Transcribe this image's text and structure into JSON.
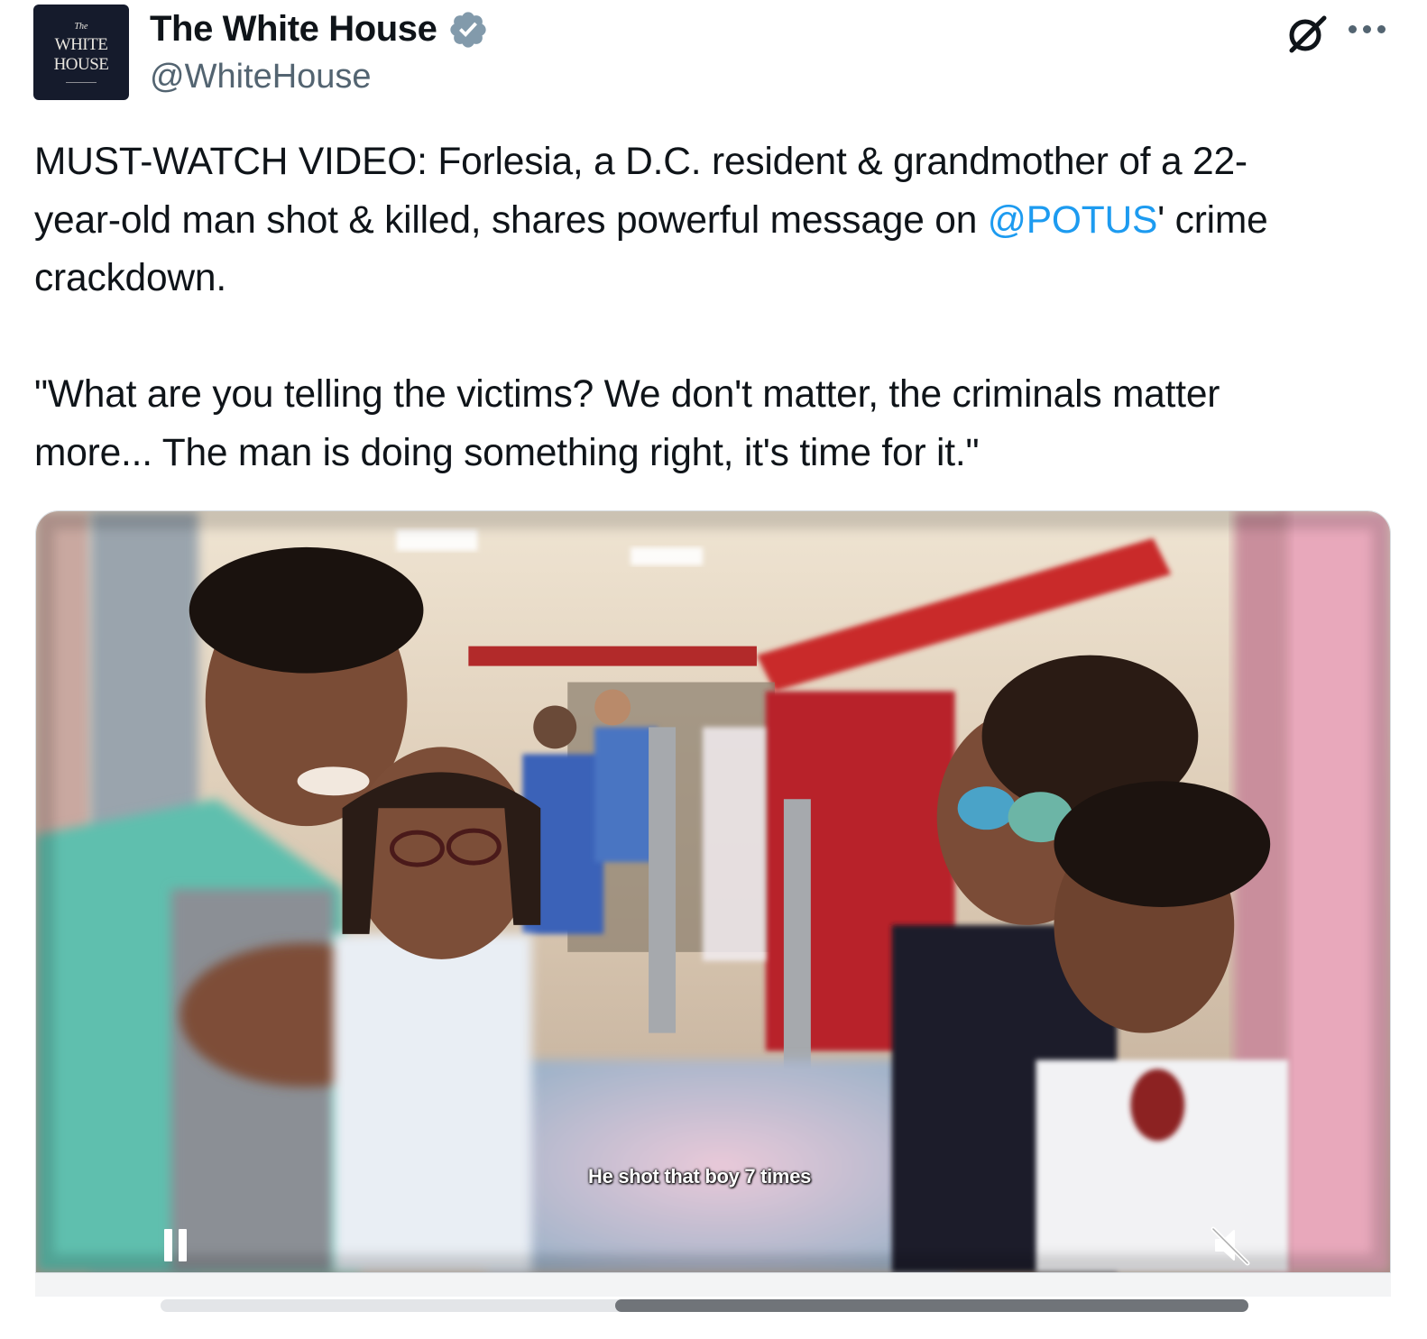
{
  "account": {
    "avatar_line1": "The",
    "avatar_line2": "WHITE",
    "avatar_line3": "HOUSE",
    "display_name": "The White House",
    "handle": "@WhiteHouse",
    "verified_icon": "verified-badge-icon"
  },
  "header_actions": {
    "grok_icon": "grok-icon",
    "more_icon": "more-dots-icon"
  },
  "tweet": {
    "text_before_mention": "MUST-WATCH VIDEO: Forlesia, a D.C. resident & grandmother of a 22-\nyear-old man shot & killed, shares powerful message on ",
    "mention": "@POTUS",
    "text_after_mention": "' crime\ncrackdown.\n\n\"What are you telling the victims? We don't matter, the criminals matter\nmore... The man is doing something right, it's time for it.\""
  },
  "video": {
    "caption": "He shot that boy 7 times",
    "pause_icon": "pause-icon",
    "mute_icon": "muted-speaker-icon",
    "progress_start_fraction": 0.418,
    "progress_end_fraction": 1.0
  },
  "colors": {
    "link": "#1d9bf0",
    "secondary_text": "#536471",
    "verified": "#829aab"
  }
}
